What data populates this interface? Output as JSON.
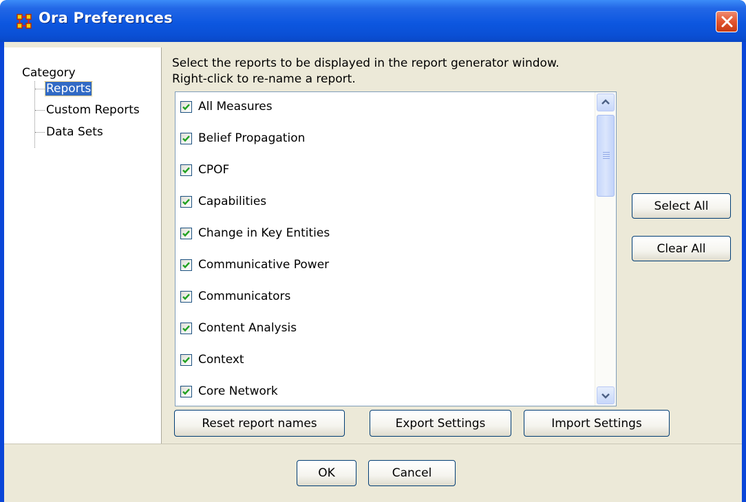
{
  "window": {
    "title": "Ora Preferences"
  },
  "tree": {
    "root": "Category",
    "items": [
      {
        "label": "Reports",
        "selected": true
      },
      {
        "label": "Custom Reports",
        "selected": false
      },
      {
        "label": "Data Sets",
        "selected": false
      }
    ]
  },
  "reports": {
    "instruction_line1": "Select the reports to be displayed in the report generator window.",
    "instruction_line2": "Right-click to re-name a report.",
    "items": [
      {
        "label": "All Measures",
        "checked": true
      },
      {
        "label": "Belief Propagation",
        "checked": true
      },
      {
        "label": "CPOF",
        "checked": true
      },
      {
        "label": "Capabilities",
        "checked": true
      },
      {
        "label": "Change in Key Entities",
        "checked": true
      },
      {
        "label": "Communicative Power",
        "checked": true
      },
      {
        "label": "Communicators",
        "checked": true
      },
      {
        "label": "Content Analysis",
        "checked": true
      },
      {
        "label": "Context",
        "checked": true
      },
      {
        "label": "Core Network",
        "checked": true
      }
    ],
    "select_all": "Select All",
    "clear_all": "Clear All",
    "reset_names": "Reset report names",
    "export_settings": "Export Settings",
    "import_settings": "Import Settings"
  },
  "footer": {
    "ok": "OK",
    "cancel": "Cancel"
  },
  "icons": {
    "app": "ora-network-icon",
    "close": "close-icon",
    "check": "check-icon",
    "scroll_up": "chevron-up-icon",
    "scroll_down": "chevron-down-icon"
  },
  "colors": {
    "title_bar": "#0a4fd4",
    "dialog_bg": "#ece9d8",
    "selection": "#316ac5",
    "check": "#21a121",
    "close_button": "#e2552f"
  }
}
